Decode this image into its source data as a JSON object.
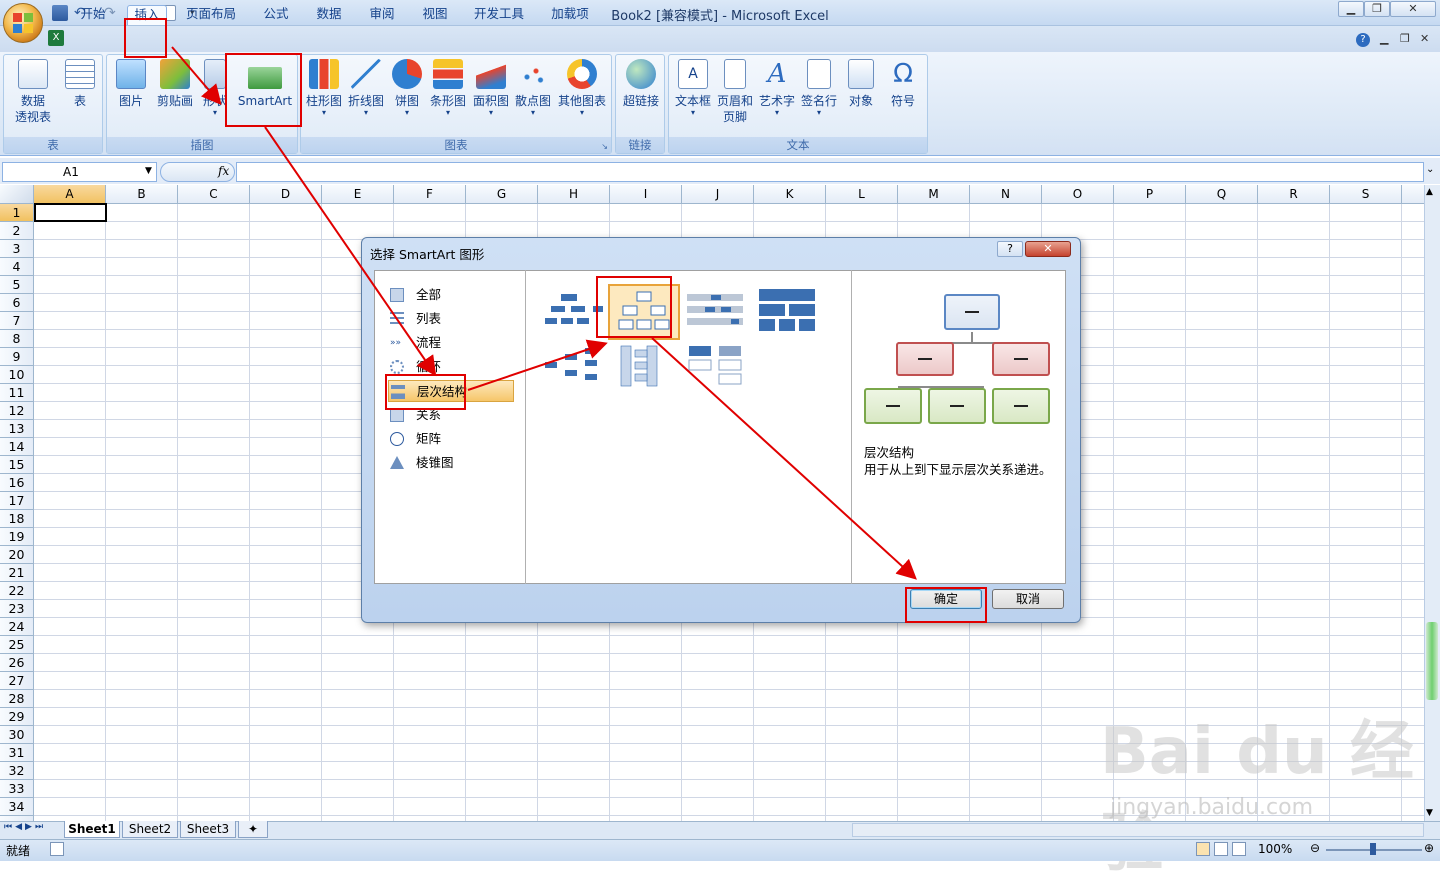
{
  "window": {
    "title": "Book2  [兼容模式] - Microsoft Excel"
  },
  "tabs": [
    "开始",
    "插入",
    "页面布局",
    "公式",
    "数据",
    "审阅",
    "视图",
    "开发工具",
    "加载项"
  ],
  "active_tab": "插入",
  "ribbon": {
    "groups": {
      "table": "表",
      "illustrations": "插图",
      "charts": "图表",
      "links": "链接",
      "text": "文本"
    },
    "buttons": {
      "pivot": "数据\n透视表",
      "pivot_line1": "数据",
      "pivot_line2": "透视表",
      "table": "表",
      "picture": "图片",
      "clipart": "剪贴画",
      "shapes": "形状",
      "smartart": "SmartArt",
      "column": "柱形图",
      "line": "折线图",
      "pie": "饼图",
      "bar": "条形图",
      "area": "面积图",
      "scatter": "散点图",
      "other": "其他图表",
      "hyperlink": "超链接",
      "textbox": "文本框",
      "header_line1": "页眉和",
      "header_line2": "页脚",
      "wordart": "艺术字",
      "signature": "签名行",
      "object": "对象",
      "symbol": "符号"
    }
  },
  "formula_bar": {
    "name_box": "A1",
    "fx": "fx",
    "value": ""
  },
  "columns": [
    "A",
    "B",
    "C",
    "D",
    "E",
    "F",
    "G",
    "H",
    "I",
    "J",
    "K",
    "L",
    "M",
    "N",
    "O",
    "P",
    "Q",
    "R",
    "S"
  ],
  "rows": [
    "1",
    "2",
    "3",
    "4",
    "5",
    "6",
    "7",
    "8",
    "9",
    "10",
    "11",
    "12",
    "13",
    "14",
    "15",
    "16",
    "17",
    "18",
    "19",
    "20",
    "21",
    "22",
    "23",
    "24",
    "25",
    "26",
    "27",
    "28",
    "29",
    "30",
    "31",
    "32",
    "33",
    "34"
  ],
  "sheets": [
    "Sheet1",
    "Sheet2",
    "Sheet3"
  ],
  "status": {
    "ready": "就绪",
    "zoom": "100%"
  },
  "dialog": {
    "title": "选择 SmartArt 图形",
    "help": "?",
    "close": "✕",
    "categories": [
      "全部",
      "列表",
      "流程",
      "循环",
      "层次结构",
      "关系",
      "矩阵",
      "棱锥图"
    ],
    "selected_category": "层次结构",
    "preview_name": "层次结构",
    "preview_desc": "用于从上到下显示层次关系递进。",
    "ok": "确定",
    "cancel": "取消"
  },
  "watermark": {
    "brand": "Bai du 经验",
    "url": "jingyan.baidu.com"
  },
  "colors": {
    "highlight": "#e00000",
    "ribbon": "#dce8f6",
    "selected": "#f6c66a"
  }
}
